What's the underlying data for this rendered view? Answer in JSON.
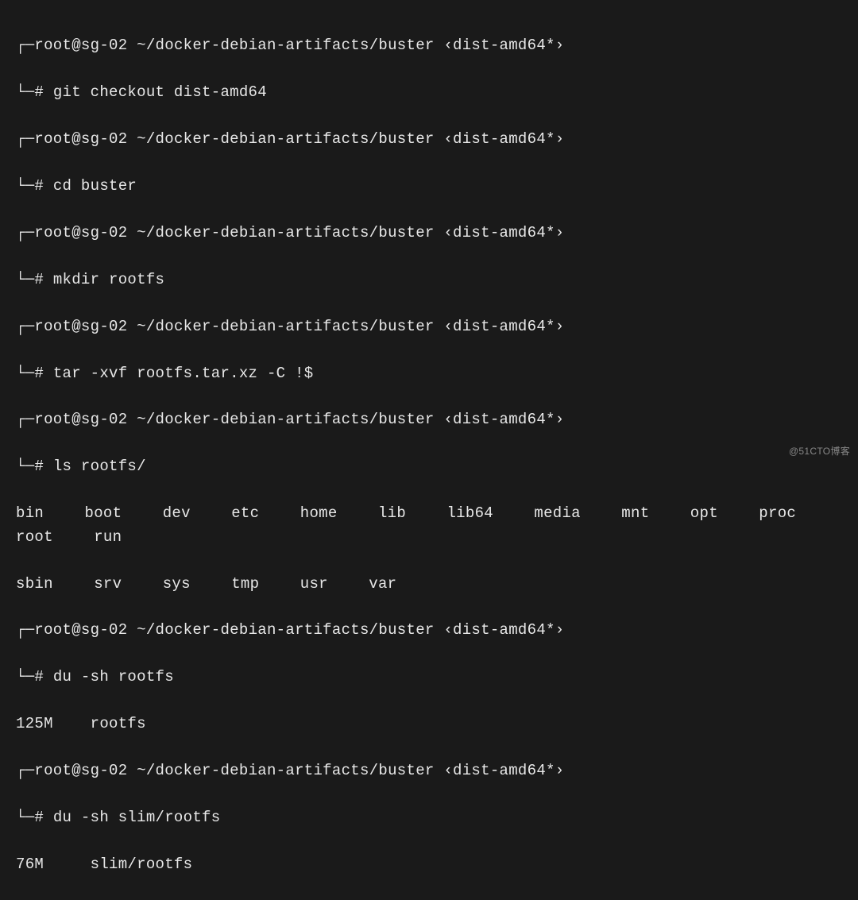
{
  "prompt": {
    "top_corner": "┌─",
    "bottom_corner": "└─",
    "user_host": "root@sg-02",
    "path": "~/docker-debian-artifacts/buster",
    "branch_open": "‹",
    "branch": "dist-amd64*",
    "branch_close": "›",
    "prompt_char": "#"
  },
  "commands": {
    "c1": "git checkout dist-amd64",
    "c2": "cd buster",
    "c3": "mkdir rootfs",
    "c4": "tar -xvf rootfs.tar.xz -C !$",
    "c5": "ls rootfs/",
    "c6": "du -sh rootfs",
    "c7": "du -sh slim/rootfs"
  },
  "ls_output": {
    "row1": "bin  boot  dev  etc  home  lib  lib64  media  mnt  opt  proc  root  run",
    "row2": "sbin  srv  sys  tmp  usr  var"
  },
  "du_output": {
    "r1": "125M    rootfs",
    "r2": "76M     slim/rootfs"
  },
  "watermark": "@51CTO博客"
}
